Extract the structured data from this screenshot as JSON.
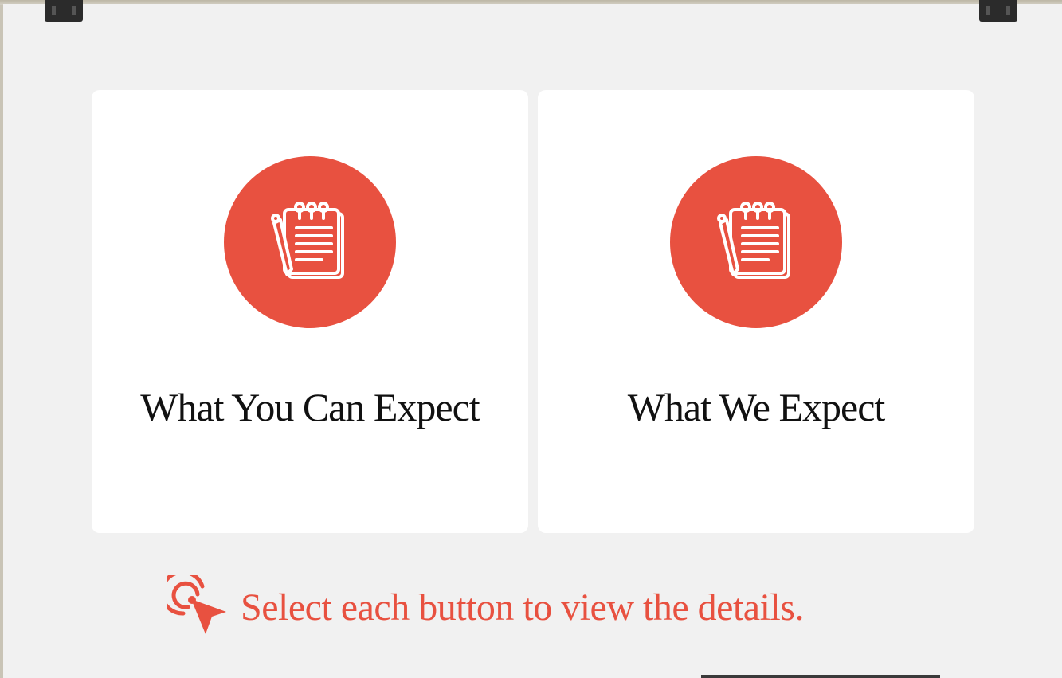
{
  "colors": {
    "accent": "#e85140",
    "card_background": "#ffffff",
    "page_background": "#f1f1f1"
  },
  "cards": [
    {
      "title": "What You Can Expect",
      "icon": "notepad-icon"
    },
    {
      "title": "What We Expect",
      "icon": "notepad-icon"
    }
  ],
  "hint": {
    "text": "Select each button to view the details.",
    "icon": "cursor-click-icon"
  }
}
